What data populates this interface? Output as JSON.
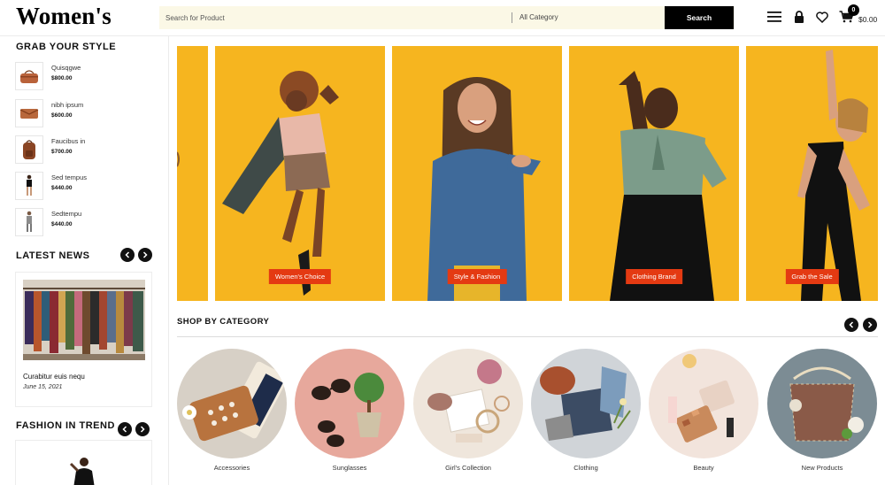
{
  "header": {
    "logo": "Women's",
    "search_placeholder": "Search for Product",
    "category_select": "All Category",
    "search_button": "Search",
    "cart_count": "0",
    "cart_total": "$0.00",
    "icons": [
      "menu-icon",
      "lock-icon",
      "heart-icon",
      "cart-icon"
    ]
  },
  "sidebar": {
    "grab_title": "GRAB YOUR STYLE",
    "products": [
      {
        "name": "Quisqgwe",
        "price": "$800.00",
        "icon": "handbag"
      },
      {
        "name": "nibh ipsum",
        "price": "$600.00",
        "icon": "clutch"
      },
      {
        "name": "Faucibus in",
        "price": "$700.00",
        "icon": "backpack"
      },
      {
        "name": "Sed tempus",
        "price": "$440.00",
        "icon": "outfit"
      },
      {
        "name": "Sedtempu",
        "price": "$440.00",
        "icon": "figure"
      }
    ],
    "news_title": "LATEST NEWS",
    "news": {
      "title": "Curabitur euis nequ",
      "date": "June 15, 2021"
    },
    "trend_title": "FASHION IN TREND"
  },
  "banner": {
    "tags": [
      "Women's Choice",
      "Style & Fashion",
      "Clothing Brand",
      "Grab the Sale"
    ],
    "background_color": "#f6b51f",
    "tag_color": "#e43a12"
  },
  "shop_by_category": {
    "title": "SHOP BY CATEGORY",
    "categories": [
      "Accessories",
      "Sunglasses",
      "Girl's Collection",
      "Clothing",
      "Beauty",
      "New Products"
    ]
  }
}
